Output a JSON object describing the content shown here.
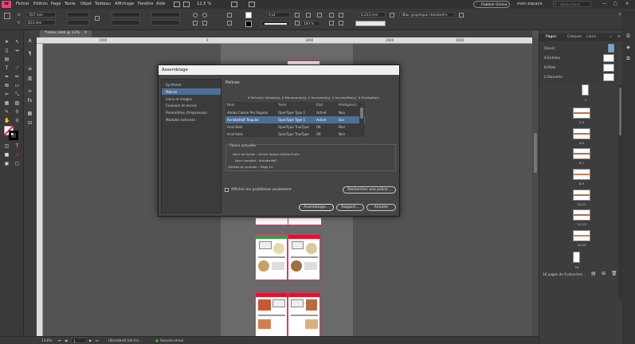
{
  "menubar": {
    "app_logo": "Id",
    "items": [
      "Fichier",
      "Edition",
      "Page",
      "Texte",
      "Objet",
      "Tableau",
      "Affichage",
      "Fenêtre",
      "Aide"
    ],
    "zoom": "12,5 %",
    "publish_label": "Publish Online",
    "workspace": "mon espace",
    "search_placeholder": "Adobe Stock"
  },
  "control_bar": {
    "x_value": "-557 mm",
    "y_value": "813 mm",
    "stroke_weight": "0 pt",
    "scale_value": "100 %",
    "size_value": "4,233 mm",
    "object_style": "[Bloc graphique standard]+"
  },
  "document": {
    "tab_label": "*index.indd @ 13%",
    "ruler_numbers": [
      "1000",
      "0",
      "1000",
      "2000",
      "3000"
    ]
  },
  "status": {
    "zoom": "13,6%",
    "page": "1",
    "master": "[Standard] (de tra...",
    "errors": "Aucune erreur"
  },
  "pages_panel": {
    "tabs": [
      "Pages",
      "Calques",
      "Liens"
    ],
    "masters": [
      "[Sans]",
      "A-Entrées",
      "B-Plats",
      "C-Desserts"
    ],
    "page_labels": [
      "1",
      "2-3",
      "4-5",
      "6-7",
      "8-9",
      "10-11",
      "12-13",
      "14-15",
      "16"
    ],
    "footer": "16 pages de 9 planches"
  },
  "dialog": {
    "title": "Assemblage",
    "nav": [
      "Synthèse",
      "Polices",
      "Liens et images",
      "Couleurs et encres",
      "Paramètres d'impression",
      "Modules externes"
    ],
    "selected_nav": "Polices",
    "heading": "Polices",
    "summary": "6 Police(s) utilisée(s), 0 Manquante(s), 0 Incorporé(s), 0 Incomplète(s), 0 Protégée(s)",
    "columns": [
      "Nom",
      "Texte",
      "Etat",
      "Protégée(s)"
    ],
    "fonts": [
      {
        "name": "Adobe Caslon Pro Regular",
        "type": "OpenType Type 1",
        "state": "Activé",
        "protected": "Non"
      },
      {
        "name": "AnnabelleJF Regular",
        "type": "OpenType Type 1",
        "state": "Activé",
        "protected": "Oui"
      },
      {
        "name": "Arial Bold",
        "type": "OpenType TrueType",
        "state": "OK",
        "protected": "Non"
      },
      {
        "name": "Arial Italic",
        "type": "OpenType TrueType",
        "state": "OK",
        "protected": "Non"
      }
    ],
    "current_font_title": "Police actuelle",
    "file_line": "Nom de fichier : Activé depuis Adobe Fonts",
    "full_name_line": "Nom complet : AnnabelleJF",
    "first_use_line": "Utilisée en premier : Page 14",
    "problems_only": "Afficher les problèmes seulement",
    "find_font": "Rechercher une police...",
    "package": "Assemblage...",
    "report": "Rapport...",
    "cancel": "Annuler"
  }
}
